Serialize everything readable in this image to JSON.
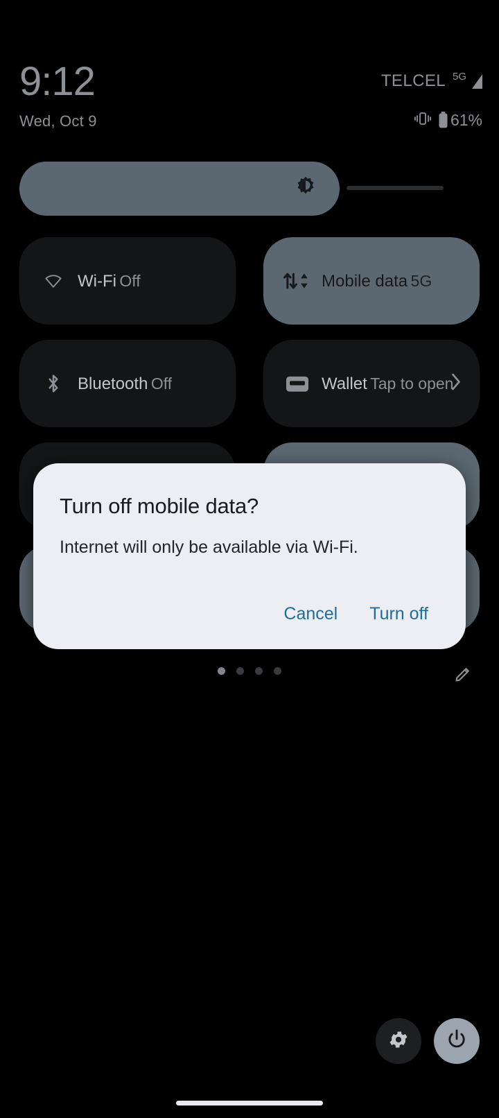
{
  "status_bar": {
    "time": "9:12",
    "date": "Wed, Oct 9",
    "carrier": "TELCEL",
    "network_type": "5G",
    "signal_icon": "signal-bars-icon",
    "vibrate_icon": "vibrate-icon",
    "battery_icon": "battery-icon",
    "battery_percent": "61%"
  },
  "brightness": {
    "name": "brightness-slider",
    "icon": "brightness-icon",
    "value_percent": 72
  },
  "tiles": [
    {
      "name": "wifi",
      "icon": "wifi-off-icon",
      "label": "Wi-Fi",
      "sub": "Off",
      "active": false,
      "chevron": false
    },
    {
      "name": "mobile-data",
      "icon": "mobile-data-icon",
      "label": "Mobile data",
      "sub": "5G",
      "active": true,
      "chevron": false
    },
    {
      "name": "bluetooth",
      "icon": "bluetooth-icon",
      "label": "Bluetooth",
      "sub": "Off",
      "active": false,
      "chevron": false
    },
    {
      "name": "wallet",
      "icon": "wallet-icon",
      "label": "Wallet",
      "sub": "Tap to open",
      "active": false,
      "chevron": true
    },
    {
      "name": "tile-row3-left",
      "icon": "",
      "label": "",
      "sub": "",
      "active": false,
      "chevron": false
    },
    {
      "name": "tile-row3-right",
      "icon": "",
      "label": "",
      "sub": "",
      "active": true,
      "chevron": false
    },
    {
      "name": "tile-row4-left",
      "icon": "",
      "label": "",
      "sub": "",
      "active": true,
      "chevron": false
    },
    {
      "name": "tile-row4-right",
      "icon": "",
      "label": "",
      "sub": "",
      "active": true,
      "chevron": false
    }
  ],
  "pager": {
    "total_pages": 4,
    "current_page": 1,
    "edit_icon": "pencil-icon"
  },
  "bottom_actions": {
    "settings_icon": "gear-icon",
    "power_icon": "power-icon"
  },
  "dialog": {
    "title": "Turn off mobile data?",
    "message": "Internet will only be available via Wi-Fi.",
    "cancel_label": "Cancel",
    "confirm_label": "Turn off"
  },
  "colors": {
    "background": "#000000",
    "tile_inactive": "#131516",
    "tile_active": "#5b6872",
    "dialog_bg": "#eceef3",
    "dialog_accent": "#1a6f9e",
    "text_primary": "#c3c6cb",
    "text_secondary": "#8d9095"
  }
}
